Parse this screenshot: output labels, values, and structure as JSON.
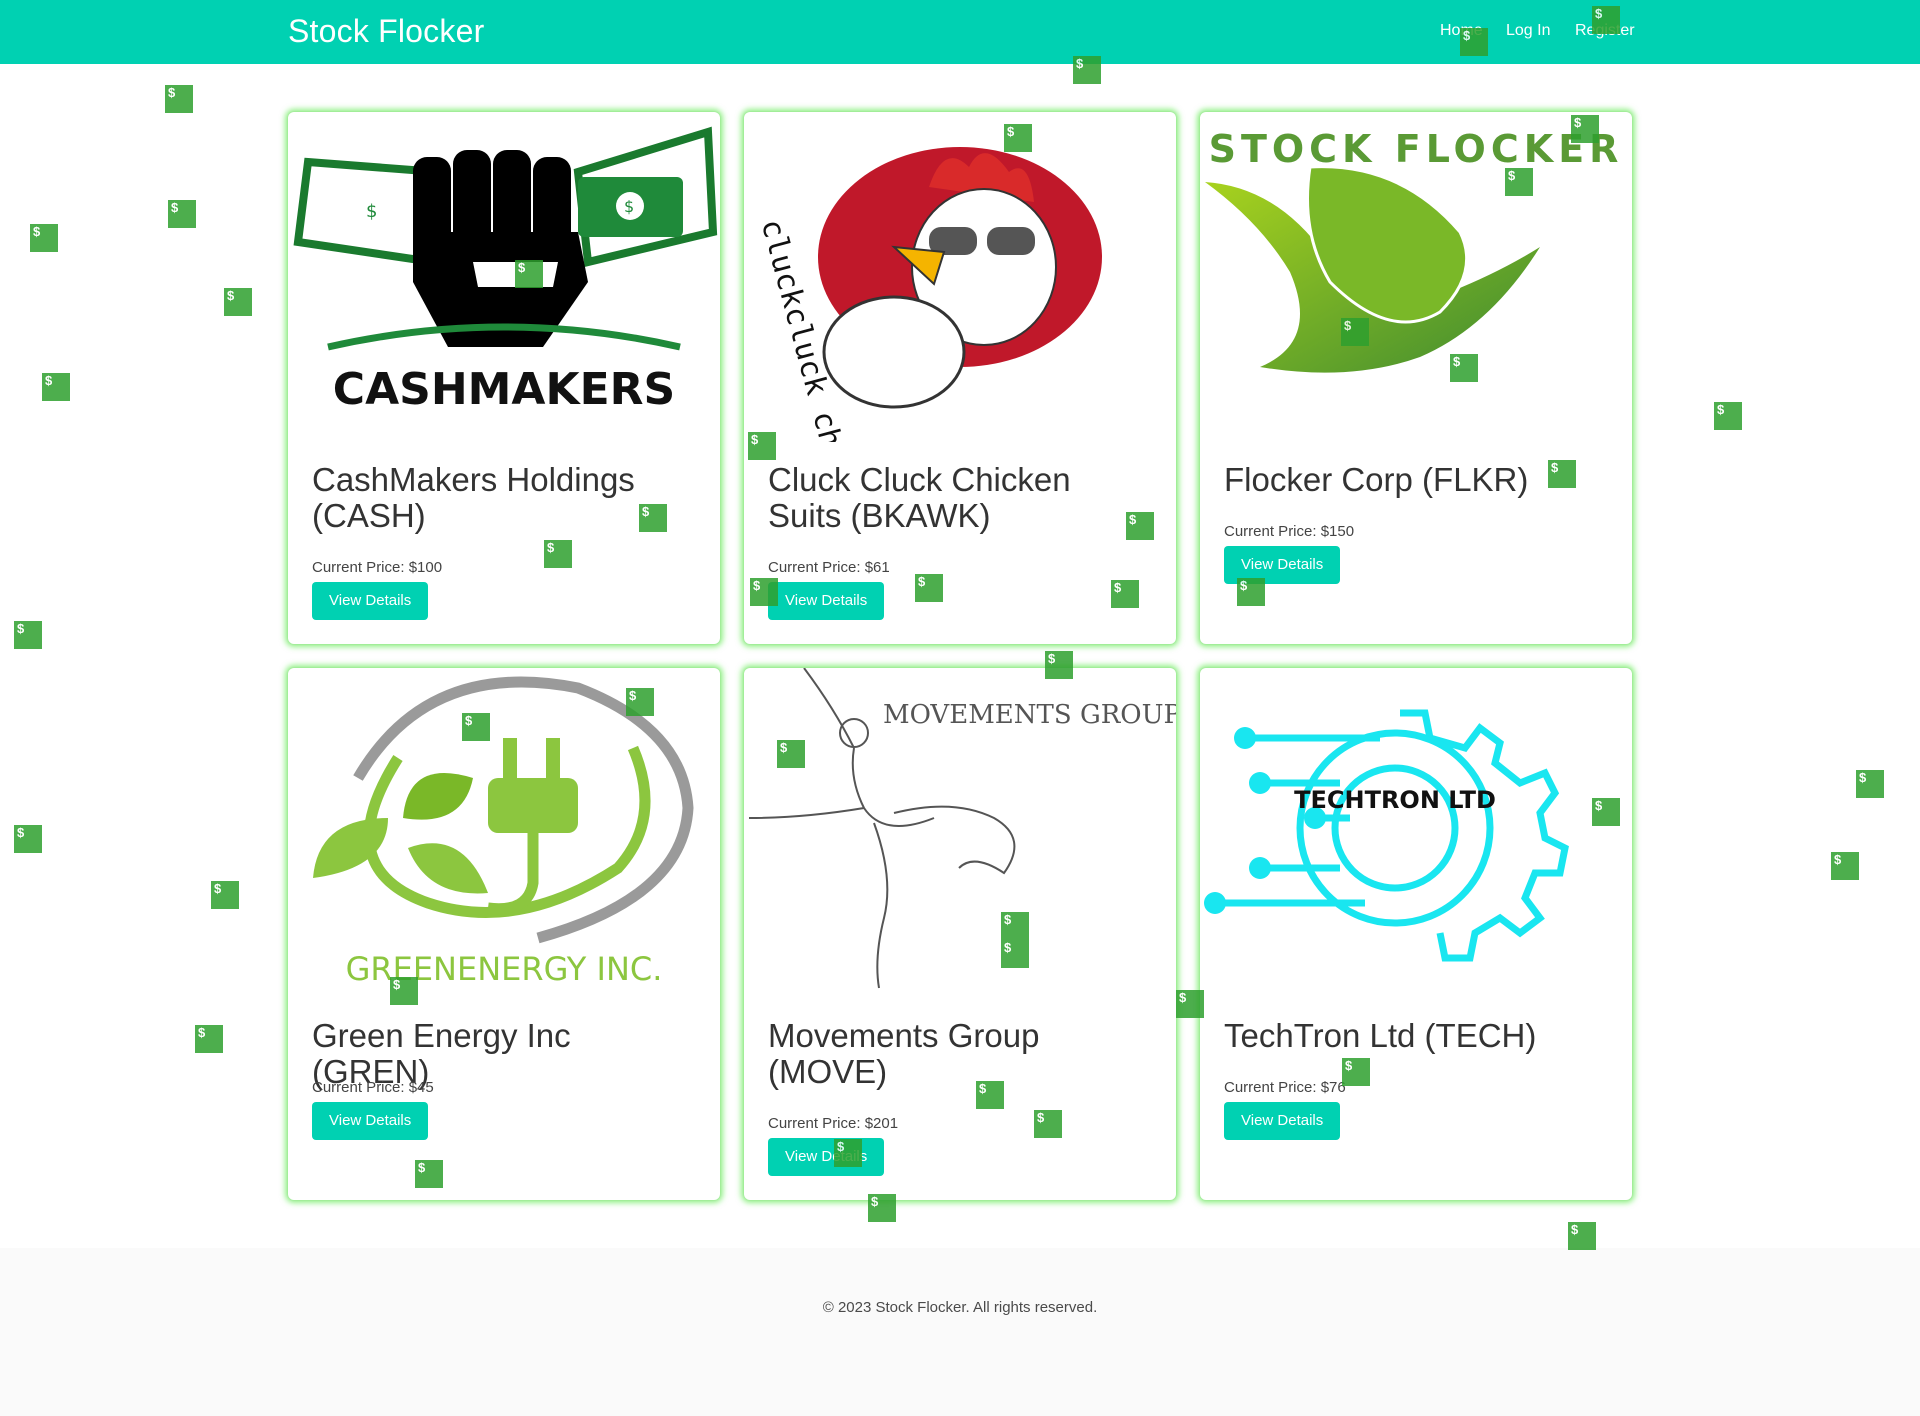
{
  "navbar": {
    "brand": "Stock Flocker",
    "links": [
      "Home",
      "Log In",
      "Register"
    ]
  },
  "cards": [
    {
      "logo": "cashmakers-logo",
      "logo_text": "CASHMAKERS",
      "title": "CashMakers Holdings (CASH)",
      "price": "Current Price: $100",
      "button": "View Details"
    },
    {
      "logo": "cluck-cluck-logo",
      "logo_text": "cluckcluck chicken suits",
      "title": "Cluck Cluck Chicken Suits (BKAWK)",
      "price": "Current Price: $61",
      "button": "View Details"
    },
    {
      "logo": "stock-flocker-logo",
      "logo_text": "STOCK FLOCKER",
      "title": "Flocker Corp (FLKR)",
      "price": "Current Price: $150",
      "button": "View Details"
    },
    {
      "logo": "green-energy-logo",
      "logo_text": "GREENENERGY INC.",
      "title": "Green Energy Inc (GREN)",
      "price": "Current Price: $45",
      "button": "View Details"
    },
    {
      "logo": "movements-group-logo",
      "logo_text": "MOVEMENTS GROUP",
      "title": "Movements Group (MOVE)",
      "price": "Current Price: $201",
      "button": "View Details"
    },
    {
      "logo": "techtron-logo",
      "logo_text": "TECHTRON LTD",
      "title": "TechTron Ltd (TECH)",
      "price": "Current Price: $76",
      "button": "View Details"
    }
  ],
  "footer": {
    "text": "© 2023 Stock Flocker. All rights reserved."
  },
  "decor": {
    "bill_symbol": "$"
  }
}
